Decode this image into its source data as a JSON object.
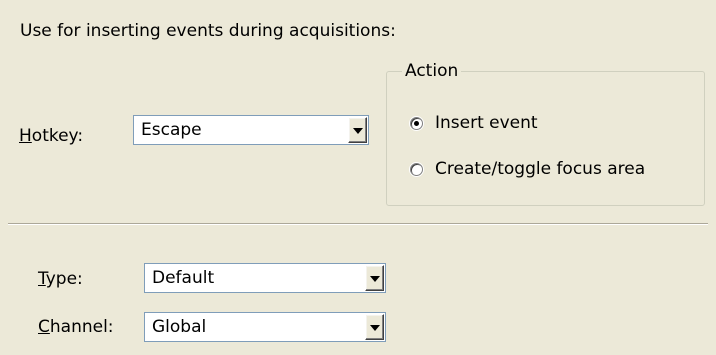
{
  "description": "Use for inserting events during acquisitions:",
  "hotkey": {
    "label_mnemonic": "H",
    "label_rest": "otkey:",
    "value": "Escape"
  },
  "action_group": {
    "title": "Action",
    "options": [
      {
        "label": "Insert event",
        "selected": true
      },
      {
        "label": "Create/toggle focus area",
        "selected": false
      }
    ]
  },
  "type": {
    "label_mnemonic": "T",
    "label_rest": "ype:",
    "value": "Default"
  },
  "channel": {
    "label_mnemonic": "C",
    "label_rest": "hannel:",
    "value": "Global"
  },
  "icons": {
    "dropdown": "chevron-down-icon",
    "radio_on": "radio-selected-icon",
    "radio_off": "radio-unselected-icon"
  }
}
